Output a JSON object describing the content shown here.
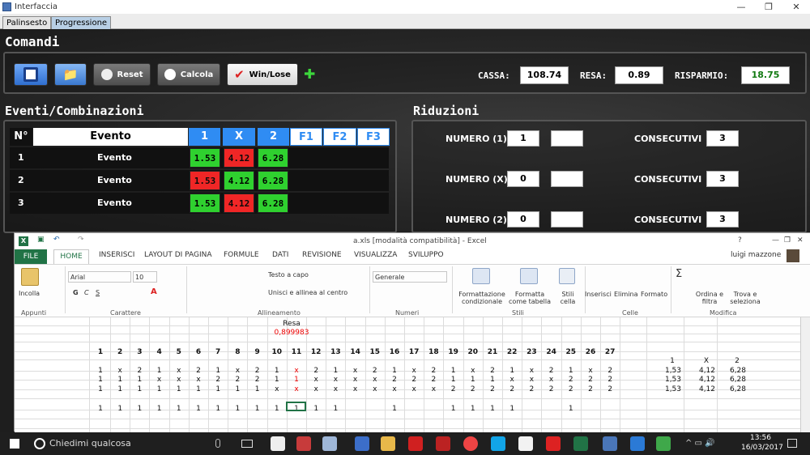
{
  "window": {
    "title": "Interfaccia"
  },
  "tabs": [
    "Palinsesto",
    "Progressione"
  ],
  "comandi": {
    "title": "Comandi",
    "reset": "Reset",
    "calcola": "Calcola",
    "winlose": "Win/Lose"
  },
  "stats": {
    "cassa_label": "CASSA:",
    "cassa": "108.74",
    "resa_label": "RESA:",
    "resa": "0.89",
    "risparmio_label": "RISPARMIO:",
    "risparmio": "18.75"
  },
  "eventi": {
    "title": "Eventi/Combinazioni",
    "headers": [
      "N°",
      "Evento",
      "1",
      "X",
      "2",
      "F1",
      "F2",
      "F3"
    ],
    "rows": [
      {
        "n": "1",
        "evento": "Evento",
        "v1": "1.53",
        "vx": "4.12",
        "v2": "6.28",
        "c1": "g",
        "cx": "r",
        "c2": "g"
      },
      {
        "n": "2",
        "evento": "Evento",
        "v1": "1.53",
        "vx": "4.12",
        "v2": "6.28",
        "c1": "r",
        "cx": "g",
        "c2": "g"
      },
      {
        "n": "3",
        "evento": "Evento",
        "v1": "1.53",
        "vx": "4.12",
        "v2": "6.28",
        "c1": "g",
        "cx": "r",
        "c2": "g"
      }
    ]
  },
  "riduzioni": {
    "title": "Riduzioni",
    "consecutivi": "CONSECUTIVI",
    "rows": [
      {
        "label": "NUMERO (1)",
        "val": "1",
        "cons": "3"
      },
      {
        "label": "NUMERO (X)",
        "val": "0",
        "cons": "3"
      },
      {
        "label": "NUMERO (2)",
        "val": "0",
        "cons": "3"
      }
    ]
  },
  "excel": {
    "title": "a.xls  [modalità compatibilità] - Excel",
    "user": "luigi mazzone",
    "tabs": [
      "FILE",
      "HOME",
      "INSERISCI",
      "LAYOUT DI PAGINA",
      "FORMULE",
      "DATI",
      "REVISIONE",
      "VISUALIZZA",
      "SVILUPPO"
    ],
    "ribbon": {
      "incolla": "Incolla",
      "appunti": "Appunti",
      "font": "Arial",
      "size": "10",
      "carattere": "Carattere",
      "testo_capo": "Testo a capo",
      "unisci": "Unisci e allinea al centro",
      "allineamento": "Allineamento",
      "formato_num": "Generale",
      "numeri": "Numeri",
      "formatt_cond": "Formattazione condizionale",
      "formatta_tab": "Formatta come tabella",
      "stili_cella": "Stili cella",
      "stili": "Stili",
      "inserisci": "Inserisci",
      "elimina": "Elimina",
      "formato": "Formato",
      "celle": "Celle",
      "ordina": "Ordina e filtra",
      "trova": "Trova e seleziona",
      "modifica": "Modifica"
    },
    "resa_label": "Resa",
    "resa_val": "0,899983",
    "cols": [
      "1",
      "2",
      "3",
      "4",
      "5",
      "6",
      "7",
      "8",
      "9",
      "10",
      "11",
      "12",
      "13",
      "14",
      "15",
      "16",
      "17",
      "18",
      "19",
      "20",
      "21",
      "22",
      "23",
      "24",
      "25",
      "26",
      "27"
    ],
    "rows": [
      [
        "1",
        "x",
        "2",
        "1",
        "x",
        "2",
        "1",
        "x",
        "2",
        "1",
        "x",
        "2",
        "1",
        "x",
        "2",
        "1",
        "x",
        "2",
        "1",
        "x",
        "2",
        "1",
        "x",
        "2",
        "1",
        "x",
        "2"
      ],
      [
        "1",
        "1",
        "1",
        "x",
        "x",
        "x",
        "2",
        "2",
        "2",
        "1",
        "1",
        "x",
        "x",
        "x",
        "x",
        "2",
        "2",
        "2",
        "1",
        "1",
        "1",
        "x",
        "x",
        "x",
        "2",
        "2",
        "2"
      ],
      [
        "1",
        "1",
        "1",
        "1",
        "1",
        "1",
        "1",
        "1",
        "1",
        "x",
        "x",
        "x",
        "x",
        "x",
        "x",
        "x",
        "x",
        "x",
        "2",
        "2",
        "2",
        "2",
        "2",
        "2",
        "2",
        "2",
        "2"
      ]
    ],
    "bottom": [
      "1",
      "1",
      "1",
      "1",
      "1",
      "1",
      "1",
      "1",
      "1",
      "1",
      "1",
      "1",
      "1",
      "",
      "",
      "1",
      "",
      "",
      "1",
      "1",
      "1",
      "1",
      "",
      "",
      "1",
      "",
      ""
    ],
    "side_head": [
      "1",
      "X",
      "2"
    ],
    "side_rows": [
      [
        "1,53",
        "4,12",
        "6,28"
      ],
      [
        "1,53",
        "4,12",
        "6,28"
      ],
      [
        "1,53",
        "4,12",
        "6,28"
      ]
    ]
  },
  "taskbar": {
    "search": "Chiedimi qualcosa",
    "time": "13:56",
    "date": "16/03/2017"
  }
}
